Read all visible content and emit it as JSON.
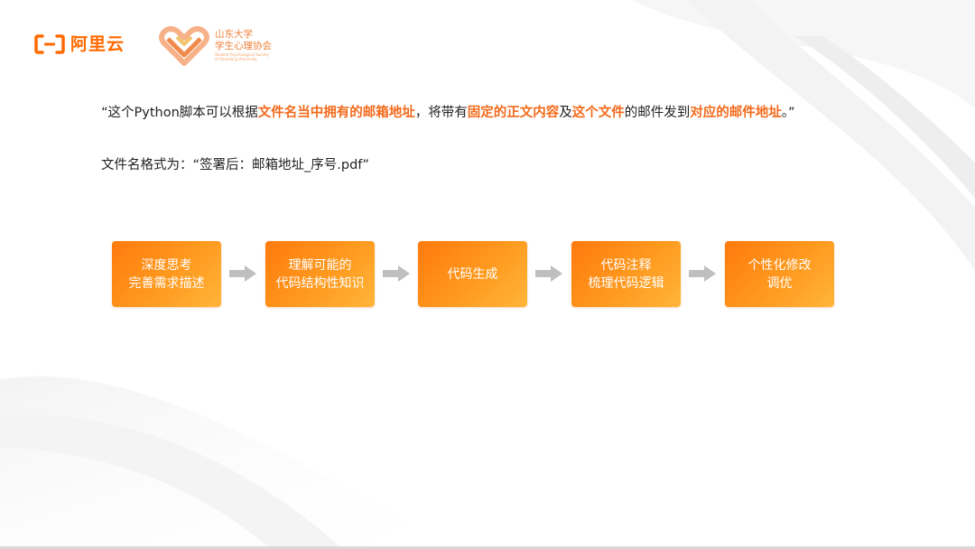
{
  "logos": {
    "aliyun_text": "阿里云",
    "sdu_line1": "山东大学",
    "sdu_line2": "学生心理协会",
    "sdu_en_line1": "Student Psychological Society",
    "sdu_en_line2": "of Shandong University"
  },
  "quote": {
    "open_mark": "“",
    "t1": "这个Python脚本可以根据",
    "h1": "文件名当中拥有的邮箱地址",
    "t2": "，将带有",
    "h2": "固定的正文内容",
    "t3": "及",
    "h3": "这个文件",
    "t4": "的邮件发到",
    "h4": "对应的邮件地址",
    "t5": "。",
    "close_mark": "”"
  },
  "filename_format": "文件名格式为：“签署后：邮箱地址_序号.pdf”",
  "flow": {
    "steps": [
      {
        "line1": "深度思考",
        "line2": "完善需求描述"
      },
      {
        "line1": "理解可能的",
        "line2": "代码结构性知识"
      },
      {
        "line1": "代码生成",
        "line2": ""
      },
      {
        "line1": "代码注释",
        "line2": "梳理代码逻辑"
      },
      {
        "line1": "个性化修改",
        "line2": "调优"
      }
    ]
  },
  "colors": {
    "accent": "#ff7a0d",
    "highlight_text": "#f26a1b",
    "arrow": "#bfbfbf"
  },
  "icons": {
    "aliyun_logo": "aliyun-bracket-logo-icon",
    "sdu_logo": "heart-ribbon-logo-icon",
    "step_arrow": "right-arrow-icon"
  }
}
